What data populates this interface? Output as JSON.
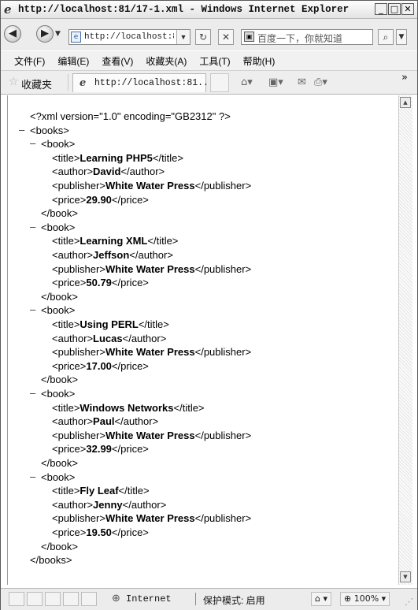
{
  "window": {
    "title": "http://localhost:81/17-1.xml - Windows Internet Explorer",
    "min_icon": "minimize-icon",
    "max_icon": "maximize-icon",
    "close_icon": "close-icon"
  },
  "address_bar": {
    "url": "http://localhost:81/17-1.xml",
    "search_placeholder": "百度一下，你就知道"
  },
  "menu": [
    "文件(F)",
    "编辑(E)",
    "查看(V)",
    "收藏夹(A)",
    "工具(T)",
    "帮助(H)"
  ],
  "favorites": {
    "label": "收藏夹",
    "tab_title": "http://localhost:81..."
  },
  "xml": {
    "declaration": "<?xml version=\"1.0\" encoding=\"GB2312\" ?>",
    "root_open": "<books>",
    "root_close": "</books>",
    "books": [
      {
        "title": "Learning PHP5",
        "author": "David",
        "publisher": "White Water Press",
        "price": "29.90"
      },
      {
        "title": "Learning XML",
        "author": "Jeffson",
        "publisher": "White Water Press",
        "price": "50.79"
      },
      {
        "title": "Using PERL",
        "author": "Lucas",
        "publisher": "White Water Press",
        "price": "17.00"
      },
      {
        "title": "Windows Networks",
        "author": "Paul",
        "publisher": "White Water Press",
        "price": "32.99"
      },
      {
        "title": "Fly Leaf",
        "author": "Jenny",
        "publisher": "White Water Press",
        "price": "19.50"
      }
    ]
  },
  "status_bar": {
    "zone": "Internet",
    "protected_mode": "保护模式: 启用",
    "zoom": "100%"
  }
}
